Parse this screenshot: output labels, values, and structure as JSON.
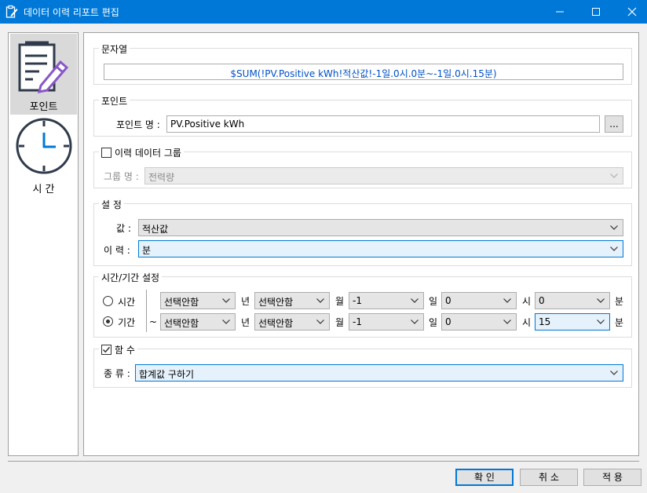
{
  "window": {
    "title": "데이터 이력 리포트 편집"
  },
  "nav": {
    "point": "포인트",
    "time": "시 간"
  },
  "string_group": {
    "title": "문자열",
    "value": "$SUM(!PV.Positive kWh!적산값!-1일.0시.0분~-1일.0시.15분)"
  },
  "point_group": {
    "title": "포인트",
    "name_label": "포인트 명 :",
    "name_value": "PV.Positive kWh",
    "browse": "..."
  },
  "history_group": {
    "title": "이력 데이터 그룹",
    "checked": false,
    "name_label": "그룹 명 :",
    "name_value": "전력량"
  },
  "settings": {
    "title": "설 정",
    "value_label": "값 :",
    "value_value": "적산값",
    "history_label": "이 력 :",
    "history_value": "분"
  },
  "time_settings": {
    "title": "시간/기간 설정",
    "radio_time": "시간",
    "radio_period": "기간",
    "tilde": "~",
    "unit_year": "년",
    "unit_month": "월",
    "unit_day": "일",
    "unit_hour": "시",
    "unit_minute": "분",
    "row1": {
      "year": "선택안함",
      "month": "선택안함",
      "day": "-1",
      "hour": "0",
      "minute": "0"
    },
    "row2": {
      "year": "선택안함",
      "month": "선택안함",
      "day": "-1",
      "hour": "0",
      "minute": "15"
    }
  },
  "function_group": {
    "title": "함 수",
    "checked": true,
    "type_label": "종 류 :",
    "type_value": "합계값 구하기"
  },
  "buttons": {
    "ok": "확 인",
    "cancel": "취 소",
    "apply": "적 용"
  }
}
